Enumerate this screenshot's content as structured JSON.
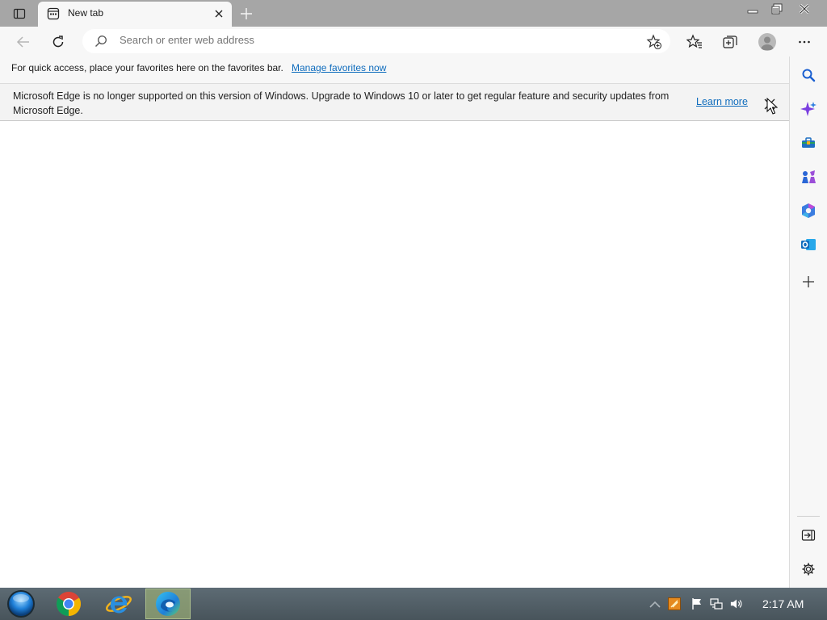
{
  "tab": {
    "title": "New tab"
  },
  "addressbar": {
    "placeholder": "Search or enter web address"
  },
  "favorites_bar": {
    "message": "For quick access, place your favorites here on the favorites bar.",
    "link": "Manage favorites now"
  },
  "infobar": {
    "message": "Microsoft Edge is no longer supported on this version of Windows. Upgrade to Windows 10 or later to get regular feature and security updates from Microsoft Edge.",
    "link": "Learn more"
  },
  "sidebar": {
    "items": [
      "search-icon",
      "copilot-icon",
      "tools-icon",
      "games-icon",
      "office-icon",
      "outlook-icon",
      "add-icon"
    ],
    "bottom": [
      "hide-sidebar-icon",
      "settings-icon"
    ]
  },
  "taskbar": {
    "apps": [
      "chrome-icon",
      "internet-explorer-icon",
      "edge-icon"
    ],
    "clock": "2:17 AM"
  },
  "colors": {
    "tabstrip": "#a6a6a6",
    "toolbar": "#f7f7f7",
    "link": "#0f6cbd",
    "taskbar": "#4f5b62"
  }
}
